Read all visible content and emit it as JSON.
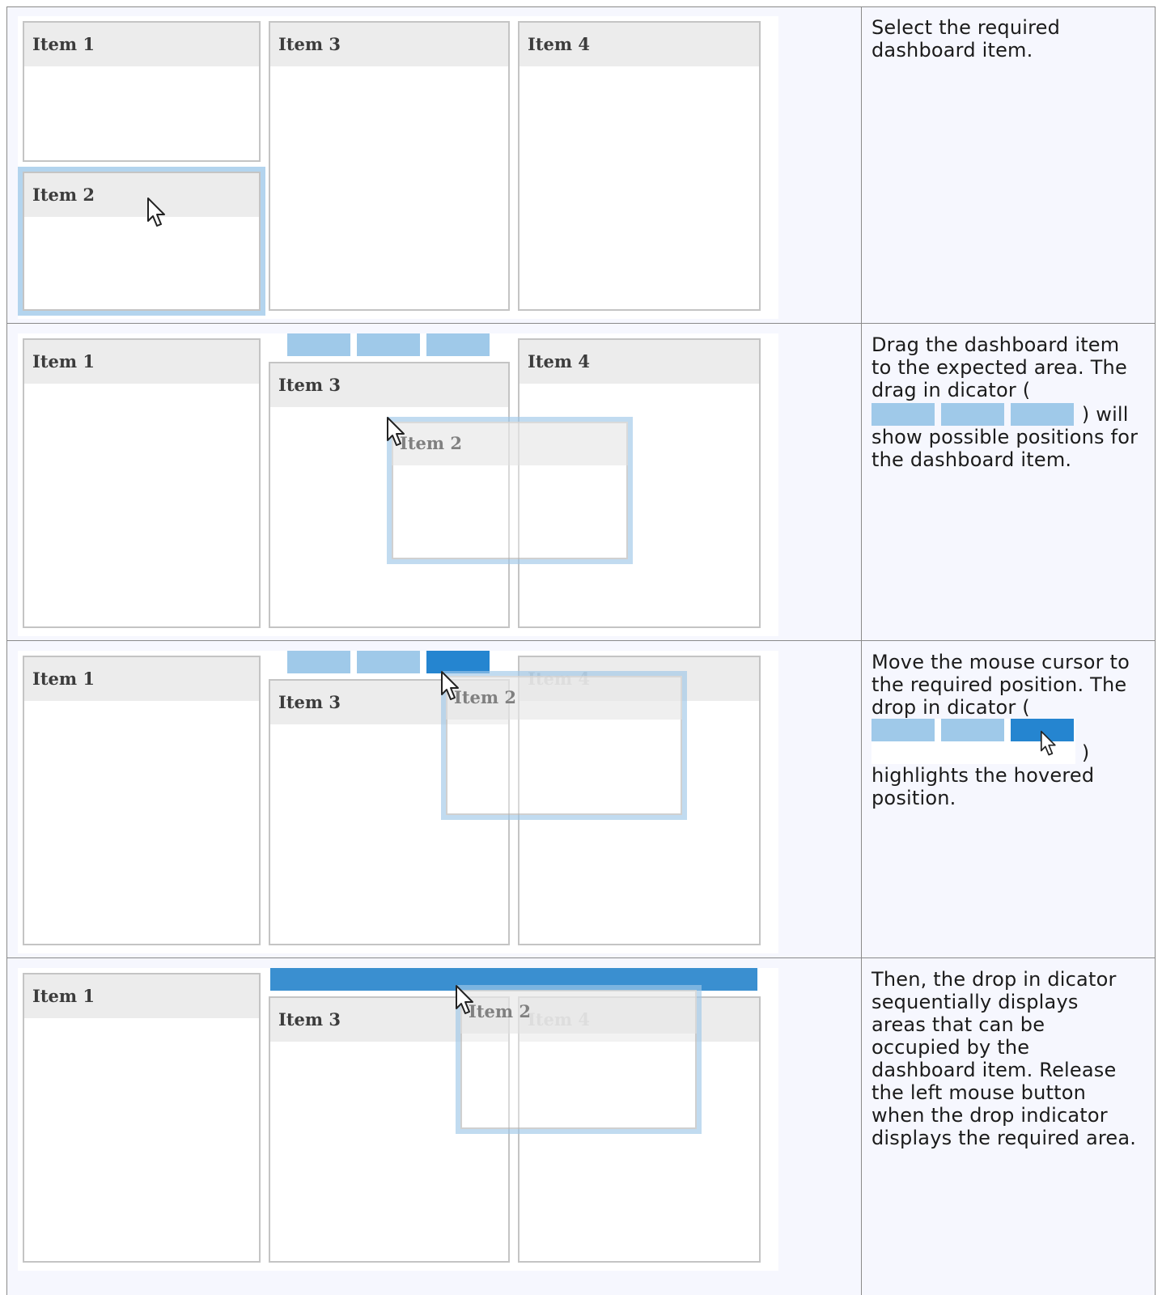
{
  "rows": [
    {
      "description": "Select the required dashboard item.",
      "items": {
        "item1": "Item 1",
        "item2": "Item 2",
        "item3": "Item 3",
        "item4": "Item 4"
      }
    },
    {
      "description_before": "Drag the dashboard item to the expected area. The drag in dicator (",
      "description_after": ") will show possible positions for the dashboard item.",
      "items": {
        "item1": "Item 1",
        "item2": "Item 2",
        "item3": "Item 3",
        "item4": "Item 4"
      }
    },
    {
      "description_before": "Move the mouse cursor to the required position. The drop in dicator (",
      "description_after": ") highlights the hovered position.",
      "items": {
        "item1": "Item 1",
        "item2": "Item 2",
        "item3": "Item 3",
        "item4": "Item 4"
      }
    },
    {
      "description": "Then, the drop in dicator sequentially displays areas that can be occupied by the dashboard item. Release the left mouse button when the drop indicator displays the required area.",
      "items": {
        "item1": "Item 1",
        "item2": "Item 2",
        "item3": "Item 3",
        "item4": "Item 4"
      }
    }
  ],
  "colors": {
    "indicator": "#9fc9e9",
    "indicator_active": "#2585d0",
    "selection": "#b3d4ee",
    "header": "#ececec"
  },
  "icons": [
    "cursor-arrow-icon"
  ]
}
